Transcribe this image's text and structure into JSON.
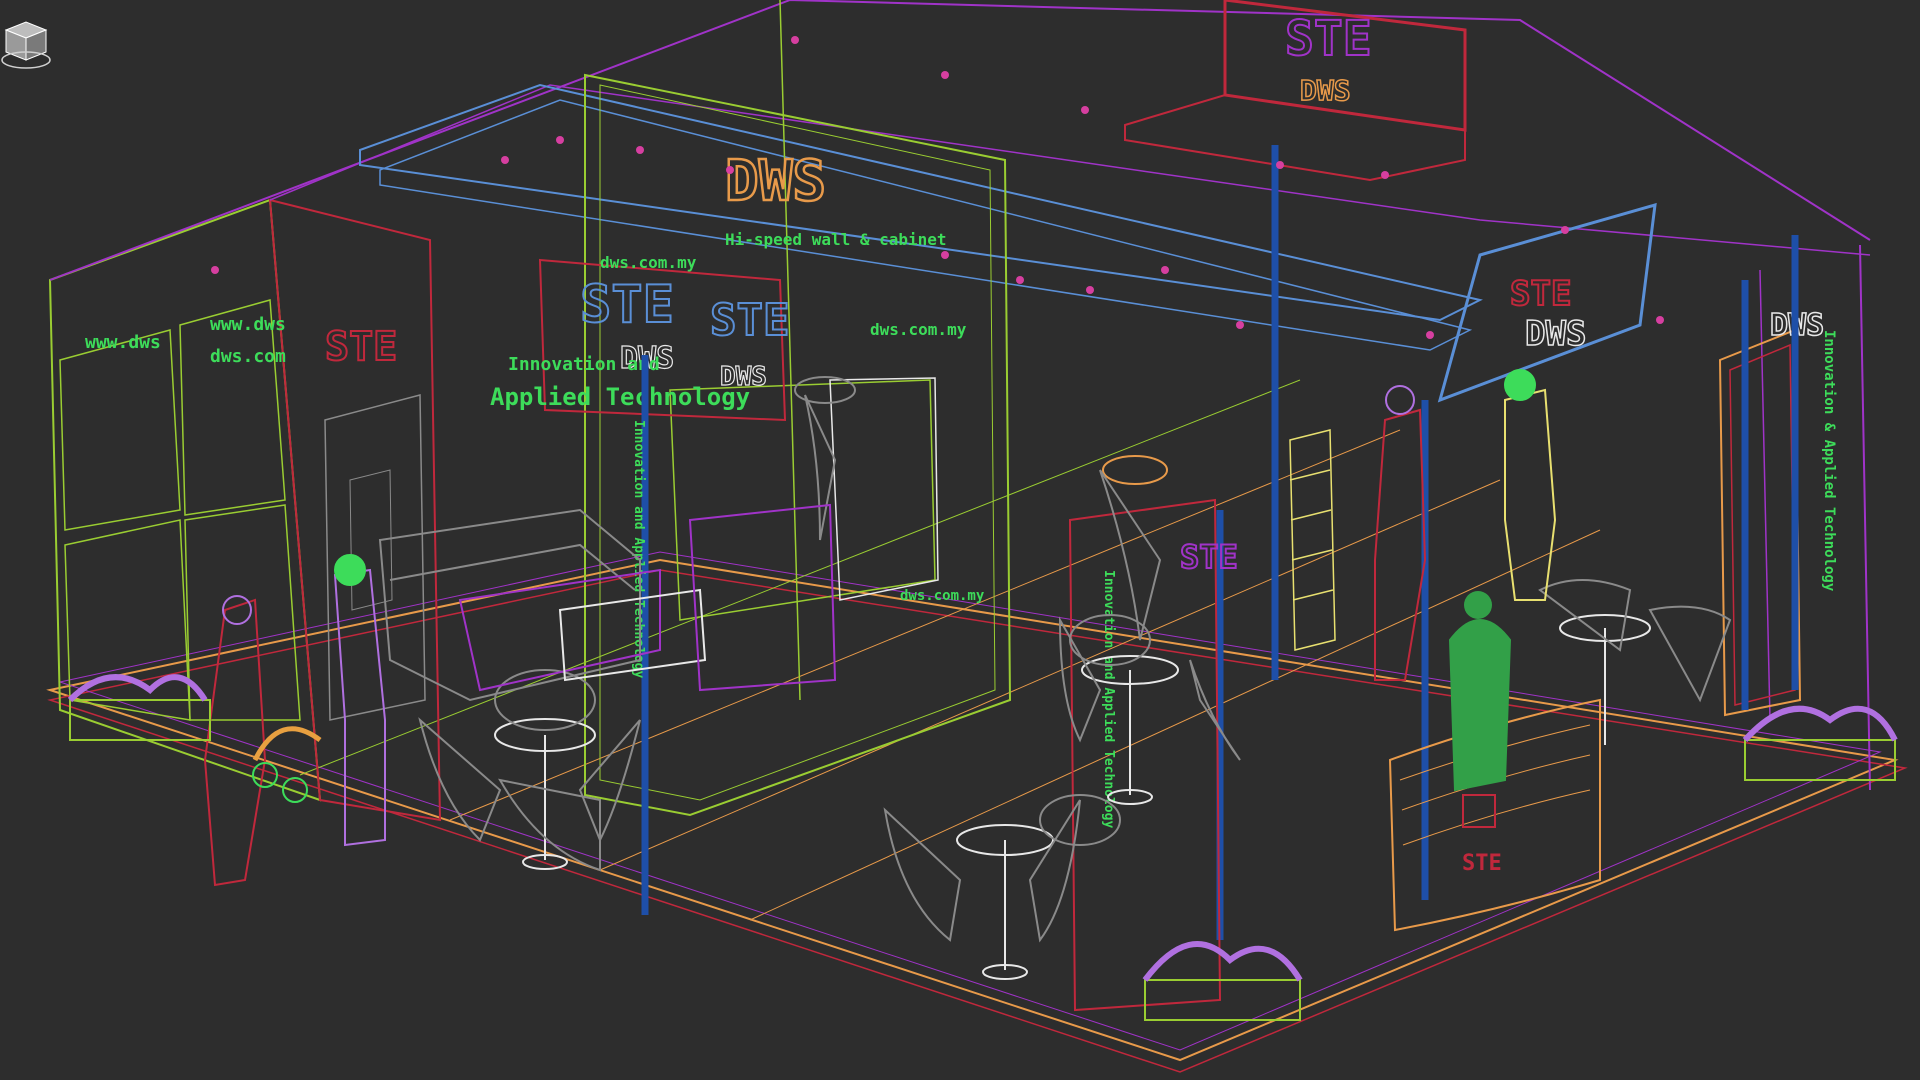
{
  "app": {
    "viewport": "Perspective wireframe"
  },
  "scene": {
    "brand": "DWS",
    "logo": "STE",
    "signs": {
      "top_banner_logo": "STE",
      "top_banner_brand": "DWS",
      "center_box_brand": "DWS",
      "center_box_tagline": "Hi-speed wall & cabinet",
      "left_wall_web": "www.dws",
      "left_wall_web2": "www.dws",
      "left_wall_url": "dws.com",
      "panel_logo_left": "STE",
      "panel_logo_right": "STE",
      "panel_brand_left": "DWS",
      "panel_brand_right": "DWS",
      "applied_line1": "Innovation and",
      "applied_line2": "Applied Technology",
      "center_box_url": "dws.com.my",
      "right_box_url": "dws.com.my",
      "side_box_url": "dws.com.my",
      "overhead_logo": "STE",
      "overhead_brand": "DWS",
      "right_wall_brand": "DWS",
      "right_wall_vertical": "Innovation & Applied Technology",
      "center_column_logo": "STE",
      "column_vertical_text": "Innovation and Applied Technology",
      "reception_logo": "STE"
    },
    "colors": {
      "background": "#2d2d2d",
      "grid_blue": "#5a8fd6",
      "violet": "#a033c8",
      "crimson": "#c0283c",
      "lime": "#9acd32",
      "green_text": "#3ddc5a",
      "orange": "#e89a4a",
      "pillar_blue": "#1e4fa8",
      "furniture_gray": "#8a8a8a",
      "plant_violet": "#b070e0"
    },
    "icons": [
      "view-cube-icon"
    ]
  }
}
